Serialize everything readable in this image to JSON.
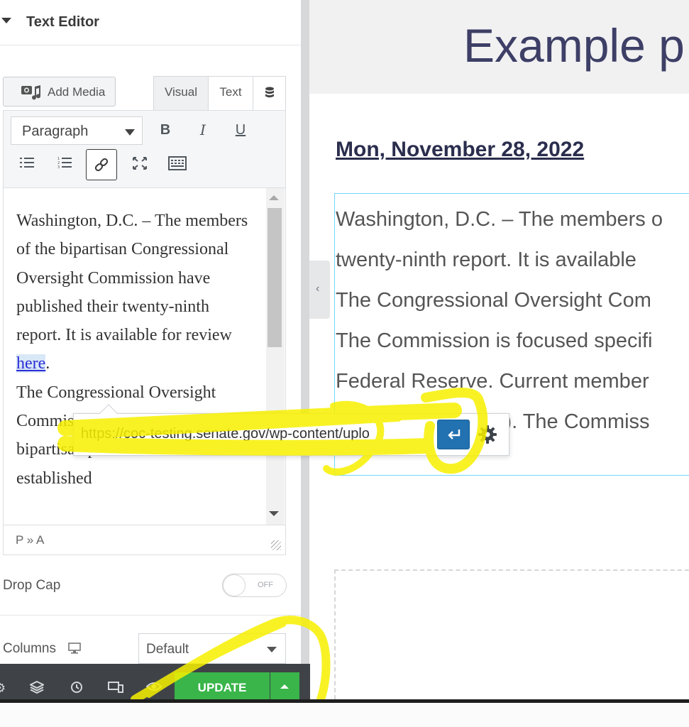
{
  "section": {
    "title": "Text Editor"
  },
  "toolbar": {
    "add_media_label": "Add Media",
    "tabs": [
      {
        "label": "Visual"
      },
      {
        "label": "Text"
      }
    ],
    "format_value": "Paragraph",
    "bold": "B",
    "italic": "I",
    "underline": "U",
    "icons": [
      "media-icon",
      "database-icon",
      "bullet-list-icon",
      "numbered-list-icon",
      "link-icon",
      "fullscreen-icon",
      "keyboard-icon"
    ]
  },
  "editor": {
    "text_before_link": "Washington, D.C. – The members of the bipartisan Congressional Oversight Commission have published their twenty-ninth report.  It is available for review ",
    "link_text": "here",
    "text_after_link": ".",
    "para2": "The Congressional Oversight Commission is a five-person, bipartisan panel that was established",
    "path": "P » A"
  },
  "link_popover": {
    "url": "https://coc-testing.senate.gov/wp-content/uplo",
    "icons": [
      "enter-icon",
      "gear-icon"
    ]
  },
  "controls": {
    "drop_cap_label": "Drop Cap",
    "drop_cap_state": "OFF",
    "columns_label": "Columns",
    "columns_value": "Default"
  },
  "footer": {
    "update_label": "UPDATE",
    "icons": [
      "settings-icon",
      "layers-icon",
      "history-icon",
      "responsive-icon",
      "preview-eye-icon"
    ]
  },
  "preview": {
    "page_title": "Example p",
    "date": "Mon, November 28, 2022",
    "lines": [
      "Washington, D.C. – The members o",
      "twenty-ninth report.  It is available",
      "The Congressional Oversight Com",
      "The Commission is focused specifi",
      "Federal Reserve. Current member",
      "French Hill (R-Ark.).  The Commiss"
    ]
  },
  "colors": {
    "accent_green": "#39b54a",
    "apply_blue": "#2271b1",
    "annotation_yellow": "#f7f000",
    "title_navy": "#3d3f66"
  }
}
